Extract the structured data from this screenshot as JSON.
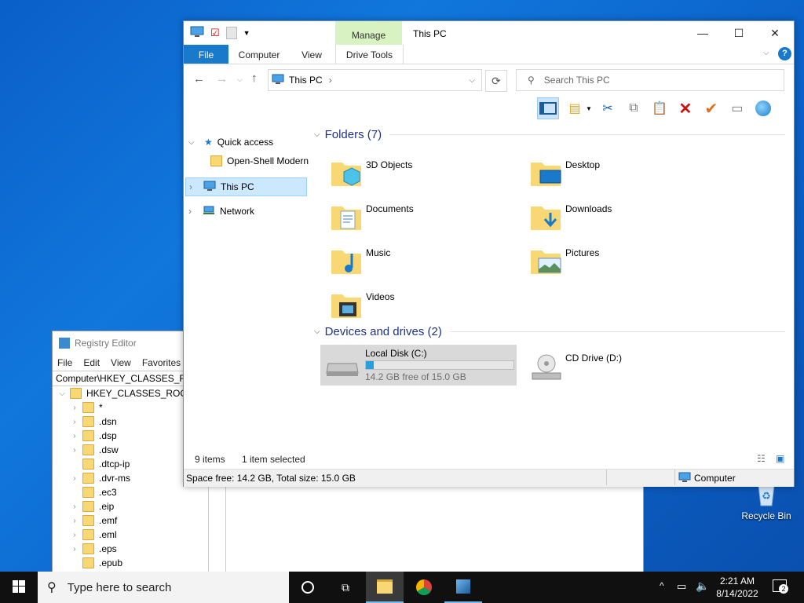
{
  "desktop": {
    "recycle_bin_label": "Recycle Bin"
  },
  "regedit": {
    "title": "Registry Editor",
    "menu": [
      "File",
      "Edit",
      "View",
      "Favorites"
    ],
    "address": "Computer\\HKEY_CLASSES_ROOT",
    "root": "HKEY_CLASSES_ROOT",
    "keys": [
      "*",
      ".dsn",
      ".dsp",
      ".dsw",
      ".dtcp-ip",
      ".dvr-ms",
      ".ec3",
      ".eip",
      ".emf",
      ".eml",
      ".eps",
      ".epub"
    ]
  },
  "explorer": {
    "title": "This PC",
    "context_tab": "Manage",
    "tabs": {
      "file": "File",
      "computer": "Computer",
      "view": "View",
      "drive_tools": "Drive Tools"
    },
    "address": "This PC",
    "search_placeholder": "Search This PC",
    "nav": {
      "quick_access": "Quick access",
      "pinned": "Open-Shell Modern",
      "this_pc": "This PC",
      "network": "Network"
    },
    "folders_header": "Folders (7)",
    "folders": [
      "3D Objects",
      "Desktop",
      "Documents",
      "Downloads",
      "Music",
      "Pictures",
      "Videos"
    ],
    "drives_header": "Devices and drives (2)",
    "drives": {
      "c_label": "Local Disk (C:)",
      "c_free": "14.2 GB free of 15.0 GB",
      "c_used_fraction": 0.053,
      "d_label": "CD Drive (D:)"
    },
    "status": {
      "items": "9 items",
      "selected": "1 item selected"
    },
    "details": {
      "space": "Space free: 14.2 GB, Total size: 15.0 GB",
      "location": "Computer"
    }
  },
  "taskbar": {
    "search_placeholder": "Type here to search",
    "time": "2:21 AM",
    "date": "8/14/2022",
    "notifications": "2"
  },
  "colors": {
    "accent": "#1979ca",
    "folder": "#f8d775",
    "selection": "#cce8ff"
  }
}
